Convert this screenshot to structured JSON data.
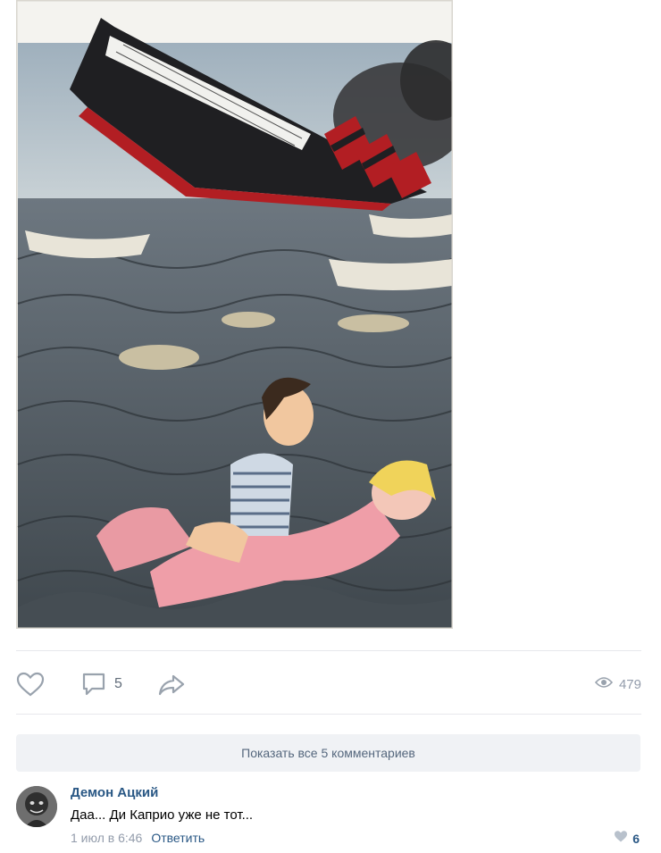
{
  "post": {
    "image_alt": "Cartoon of a sinking ocean liner with lifeboats; a man in a striped shirt floats on an inflatable doll in the sea"
  },
  "actions": {
    "comments_count": "5",
    "views_count": "479"
  },
  "comments": {
    "show_all_label": "Показать все 5 комментариев",
    "items": [
      {
        "author": "Демон Ацкий",
        "text": "Даа... Ди Каприо уже не тот...",
        "date": "1 июл в 6:46",
        "reply_label": "Ответить",
        "likes": "6"
      }
    ]
  },
  "colors": {
    "link": "#2a5885",
    "icon": "#99a2ad",
    "button_bg": "#f0f2f5"
  },
  "icons": [
    "like-heart-icon",
    "comment-bubble-icon",
    "share-arrow-icon",
    "eye-icon",
    "comment-like-heart-icon"
  ]
}
